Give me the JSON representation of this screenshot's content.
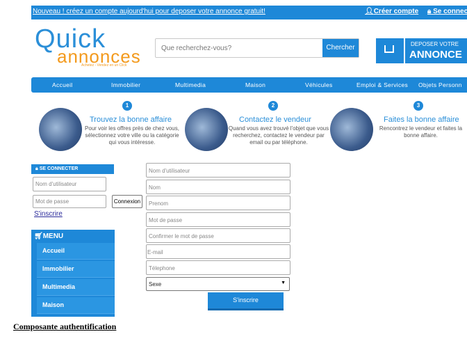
{
  "topbar": {
    "promo": "Nouveau ! créez un compte aujourd'hui pour deposer votre annonce gratuit!",
    "create_account": "Créer compte",
    "login": "Se connec"
  },
  "logo": {
    "line1": "Quick",
    "line2": "annonces",
    "tagline": "Achetez - Vendez en un Click"
  },
  "search": {
    "placeholder": "Que recherchez-vous?",
    "button": "Chercher"
  },
  "deposit": {
    "line1": "DEPOSER VOTRE",
    "line2": "ANNONCE"
  },
  "nav": [
    "Accueil",
    "Immobilier",
    "Multimedia",
    "Maison",
    "Véhicules",
    "Emploi & Services",
    "Objets Personn"
  ],
  "steps": [
    {
      "num": "1",
      "title": "Trouvez la bonne affaire",
      "desc": "Pour voir les offres près de chez vous, sélectionnez votre ville ou la catégorie qui vous intéresse."
    },
    {
      "num": "2",
      "title": "Contactez le vendeur",
      "desc": "Quand vous avez trouvé l'objet que vous recherchez, contactez le vendeur par email ou par téléphone."
    },
    {
      "num": "3",
      "title": "Faites la bonne affaire",
      "desc": "Rencontrez le vendeur et faites la bonne affaire."
    }
  ],
  "login_box": {
    "header": "SE CONNECTER",
    "username_placeholder": "Nom d'utilisateur",
    "password_placeholder": "Mot de passe",
    "button": "Connexion",
    "register_link": "S'inscrire"
  },
  "menu": {
    "header": "MENU",
    "items": [
      "Accueil",
      "Immobilier",
      "Multimedia",
      "Maison"
    ]
  },
  "register_form": {
    "fields": [
      "Nom d'utilisateur",
      "Nom",
      "Prenom",
      "Mot de passe",
      "Confirmer le mot de passe",
      "E-mail",
      "Télephone"
    ],
    "select_value": "Sexe",
    "submit": "S'inscrire"
  },
  "caption": "Composante authentification",
  "colors": {
    "primary": "#1e88d8",
    "accent": "#f39a1d"
  }
}
